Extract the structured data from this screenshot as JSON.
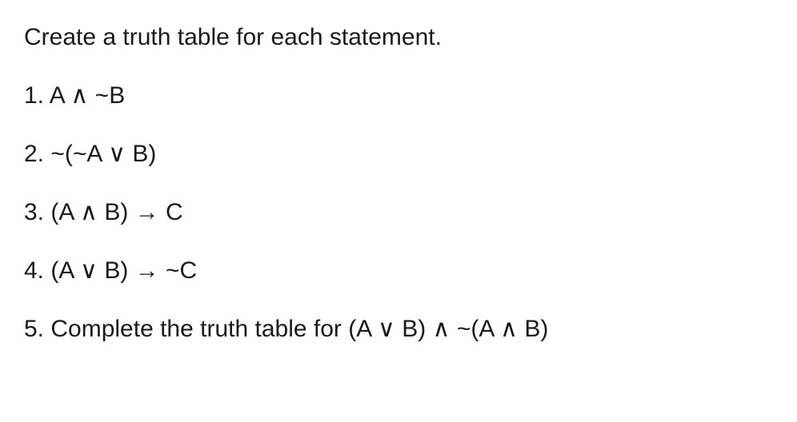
{
  "instruction": "Create a truth table for each statement.",
  "problems": {
    "p1": "1. A ∧ ~B",
    "p2": "2. ~(~A ∨ B)",
    "p3": "3. (A ∧ B) → C",
    "p4": "4. (A ∨ B) → ~C",
    "p5": "5. Complete the truth table for (A ∨ B) ∧ ~(A ∧ B)"
  }
}
